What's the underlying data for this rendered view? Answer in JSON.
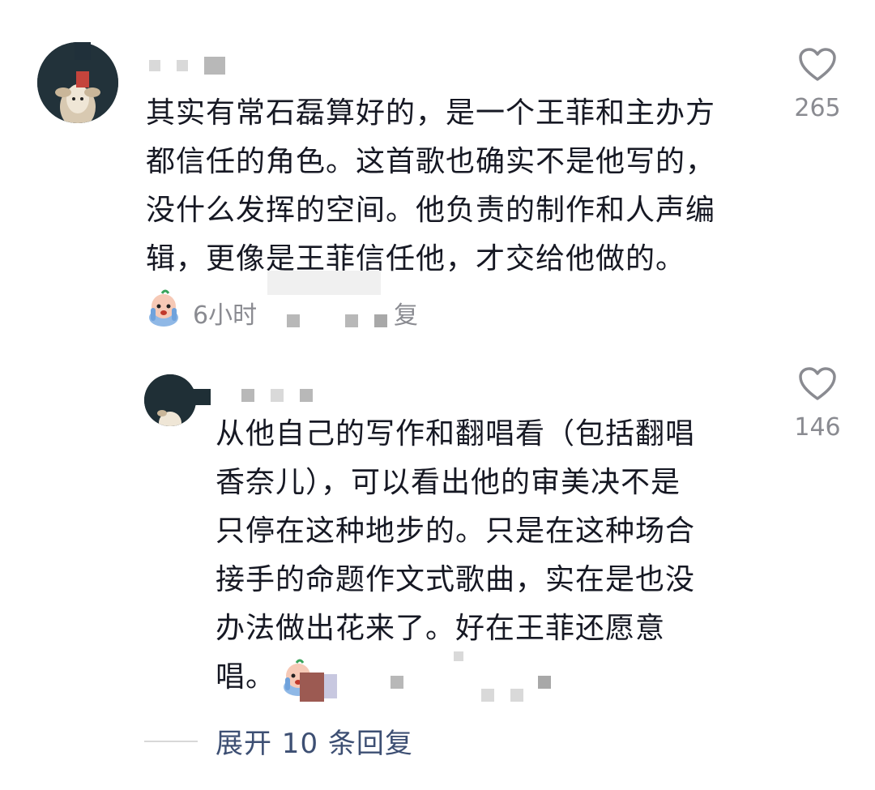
{
  "comments": [
    {
      "text": "其实有常石磊算好的，是一个王菲和主办方\n都信任的角色。这首歌也确实不是他写的，\n没什么发挥的空间。他负责的制作和人声编\n辑，更像是王菲信任他，才交给他做的。",
      "time_prefix": "6小时",
      "reply_label": "复",
      "likes": "265"
    }
  ],
  "reply": {
    "text": "从他自己的写作和翻唱看（包括翻唱\n香奈儿），可以看出他的审美决不是\n只停在这种地步的。只是在这种场合\n接手的命题作文式歌曲，实在是也没\n办法做出花来了。好在王菲还愿意\n唱。",
    "likes": "146"
  },
  "expand_label": "展开 10 条回复",
  "colors": {
    "text": "#161823",
    "meta": "#8a8b91",
    "link": "#3d4f73"
  },
  "icons": [
    "heart-outline-icon",
    "crying-emoji-icon"
  ]
}
